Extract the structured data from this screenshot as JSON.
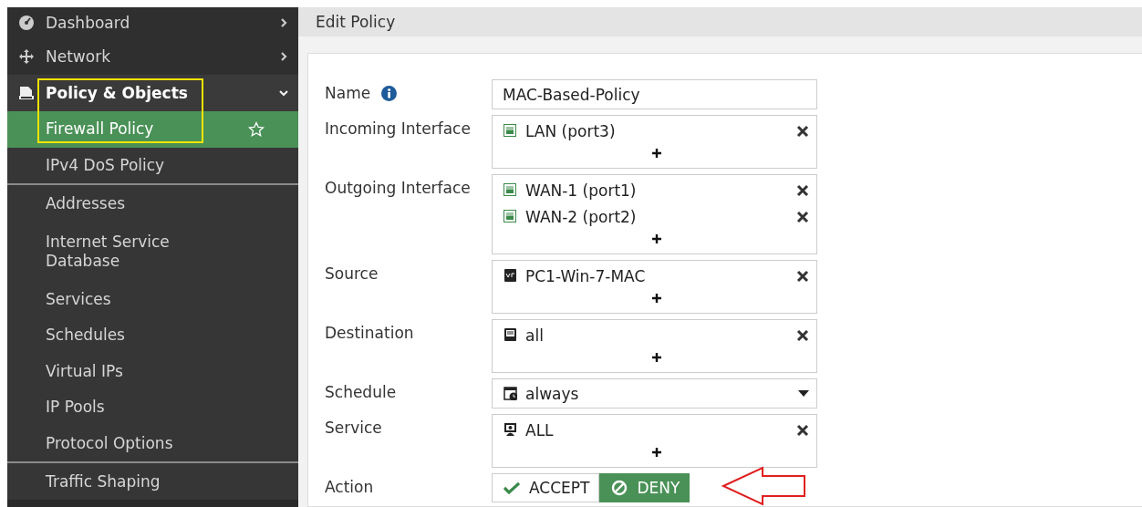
{
  "sidebar": {
    "items": [
      {
        "kind": "section",
        "label": "Dashboard",
        "expanded": false,
        "selected": false
      },
      {
        "kind": "section",
        "label": "Network",
        "expanded": false,
        "selected": false
      },
      {
        "kind": "section",
        "label": "Policy & Objects",
        "expanded": true,
        "selected": false
      },
      {
        "kind": "item",
        "label": "Firewall Policy",
        "selected": true,
        "favorite": false
      },
      {
        "kind": "item",
        "label": "IPv4 DoS Policy",
        "selected": false,
        "divider_after": true
      },
      {
        "kind": "item",
        "label": "Addresses",
        "selected": false
      },
      {
        "kind": "item",
        "label": "Internet Service Database",
        "selected": false
      },
      {
        "kind": "item",
        "label": "Services",
        "selected": false
      },
      {
        "kind": "item",
        "label": "Schedules",
        "selected": false
      },
      {
        "kind": "item",
        "label": "Virtual IPs",
        "selected": false
      },
      {
        "kind": "item",
        "label": "IP Pools",
        "selected": false
      },
      {
        "kind": "item",
        "label": "Protocol Options",
        "selected": false,
        "divider_after": true
      },
      {
        "kind": "item",
        "label": "Traffic Shaping",
        "selected": false
      }
    ]
  },
  "page": {
    "title": "Edit Policy"
  },
  "form": {
    "fields": [
      {
        "kind": "text",
        "label": "Name",
        "info": true,
        "value": "MAC-Based-Policy"
      },
      {
        "kind": "multi",
        "label": "Incoming Interface",
        "entries": [
          {
            "kind": "port",
            "text": "LAN (port3)"
          }
        ]
      },
      {
        "kind": "multi",
        "label": "Outgoing Interface",
        "entries": [
          {
            "kind": "port",
            "text": "WAN-1 (port1)"
          },
          {
            "kind": "port",
            "text": "WAN-2 (port2)"
          }
        ]
      },
      {
        "kind": "multi",
        "label": "Source",
        "entries": [
          {
            "kind": "mac",
            "text": "PC1-Win-7-MAC"
          }
        ]
      },
      {
        "kind": "multi",
        "label": "Destination",
        "entries": [
          {
            "kind": "address",
            "text": "all"
          }
        ]
      },
      {
        "kind": "select",
        "label": "Schedule",
        "value": "always"
      },
      {
        "kind": "multi",
        "label": "Service",
        "entries": [
          {
            "kind": "service",
            "text": "ALL"
          }
        ]
      },
      {
        "kind": "action",
        "label": "Action",
        "options": [
          {
            "kind": "accept",
            "text": "ACCEPT",
            "selected": false
          },
          {
            "kind": "deny",
            "text": "DENY",
            "selected": true
          }
        ]
      }
    ]
  }
}
